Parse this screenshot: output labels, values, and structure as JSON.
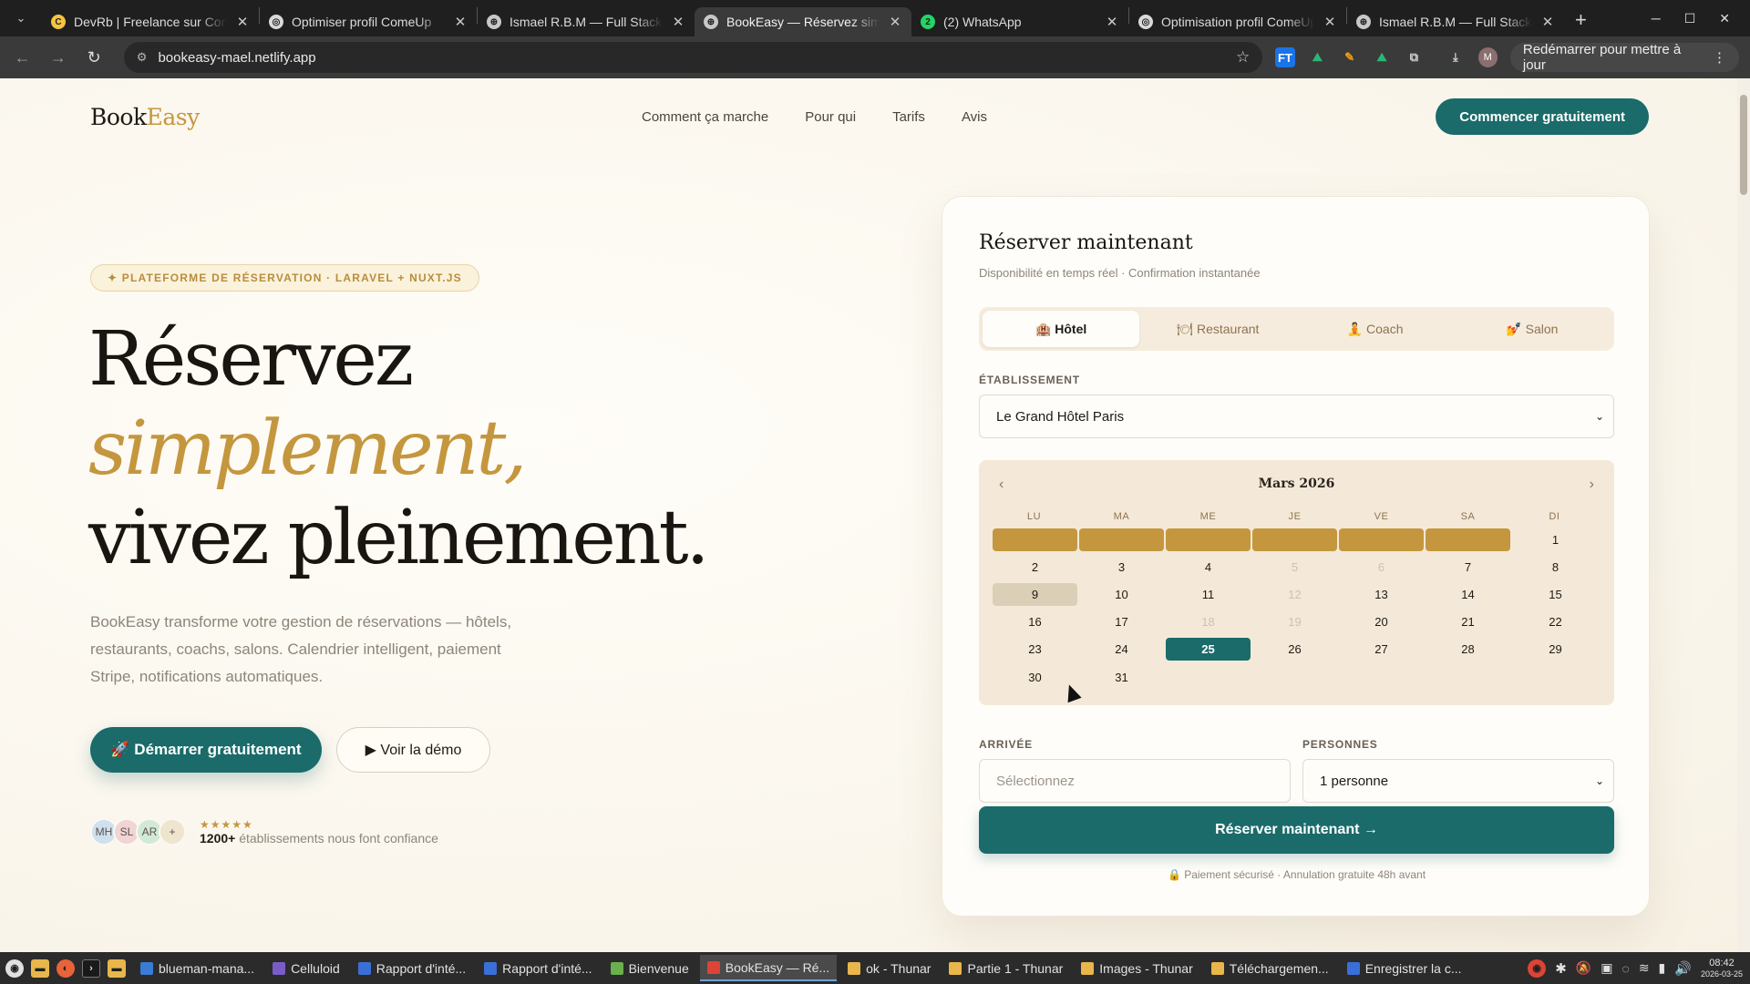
{
  "browser": {
    "tabs": [
      {
        "title": "DevRb | Freelance sur ComeUp",
        "favicon_color": "#f5c542",
        "favicon_glyph": "C"
      },
      {
        "title": "Optimiser profil ComeUp",
        "favicon_color": "#d9d9d9",
        "favicon_glyph": "◎"
      },
      {
        "title": "Ismael R.B.M — Full Stack Developer",
        "favicon_color": "#c8c8c8",
        "favicon_glyph": "⊕"
      },
      {
        "title": "BookEasy — Réservez simplement",
        "favicon_color": "#c8c8c8",
        "favicon_glyph": "⊕"
      },
      {
        "title": "(2) WhatsApp",
        "favicon_color": "#25d366",
        "favicon_glyph": "2"
      },
      {
        "title": "Optimisation profil ComeUp",
        "favicon_color": "#d9d9d9",
        "favicon_glyph": "◎"
      },
      {
        "title": "Ismael R.B.M — Full Stack Developer",
        "favicon_color": "#c8c8c8",
        "favicon_glyph": "⊕"
      }
    ],
    "active_tab": 3,
    "url": "bookeasy-mael.netlify.app",
    "update_label": "Redémarrer pour mettre à jour",
    "profile_initial": "M"
  },
  "site": {
    "logo_part1": "Book",
    "logo_part2": "Easy",
    "nav": [
      "Comment ça marche",
      "Pour qui",
      "Tarifs",
      "Avis"
    ],
    "cta_top": "Commencer gratuitement",
    "badge": "✦ PLATEFORME DE RÉSERVATION · LARAVEL + NUXT.JS",
    "hero_line1": "Réservez",
    "hero_line2": "simplement,",
    "hero_line3": "vivez pleinement.",
    "hero_desc": "BookEasy transforme votre gestion de réservations — hôtels, restaurants, coachs, salons. Calendrier intelligent, paiement Stripe, notifications automatiques.",
    "btn_primary": "🚀 Démarrer gratuitement",
    "btn_secondary": "▶ Voir la démo",
    "avatars": [
      "MH",
      "SL",
      "AR",
      "+"
    ],
    "rating_stars": "★★★★★",
    "social_count": "1200+",
    "social_text": "établissements nous font confiance"
  },
  "booking": {
    "title": "Réserver maintenant",
    "subtitle": "Disponibilité en temps réel · Confirmation instantanée",
    "segments": [
      {
        "label": "🏨 Hôtel",
        "active": true
      },
      {
        "label": "🍽 Restaurant",
        "active": false
      },
      {
        "label": "🧘 Coach",
        "active": false
      },
      {
        "label": "💅 Salon",
        "active": false
      }
    ],
    "establishment_label": "ÉTABLISSEMENT",
    "establishment_value": "Le Grand Hôtel Paris",
    "calendar": {
      "month": "Mars 2026",
      "prev": "‹",
      "next": "›",
      "weekdays": [
        "LU",
        "MA",
        "ME",
        "JE",
        "VE",
        "SA",
        "DI"
      ],
      "weeks": [
        [
          "",
          "",
          "",
          "",
          "",
          "",
          "1"
        ],
        [
          "2",
          "3",
          "4",
          "5",
          "6",
          "7",
          "8"
        ],
        [
          "9",
          "10",
          "11",
          "12",
          "13",
          "14",
          "15"
        ],
        [
          "16",
          "17",
          "18",
          "19",
          "20",
          "21",
          "22"
        ],
        [
          "23",
          "24",
          "25",
          "26",
          "27",
          "28",
          "29"
        ],
        [
          "30",
          "31",
          "",
          "",
          "",
          "",
          ""
        ]
      ],
      "disabled_days": [
        "5",
        "6",
        "12",
        "18",
        "19"
      ],
      "hovered_day": "9",
      "selected_day": "25"
    },
    "arrival_label": "ARRIVÉE",
    "arrival_placeholder": "Sélectionnez",
    "persons_label": "PERSONNES",
    "persons_value": "1 personne",
    "submit": "Réserver maintenant →",
    "secure_note": "🔒 Paiement sécurisé · Annulation gratuite 48h avant"
  },
  "taskbar": {
    "items": [
      {
        "label": "blueman-mana...",
        "color": "#3a7bd5"
      },
      {
        "label": "Celluloid",
        "color": "#7a5cc9"
      },
      {
        "label": "Rapport d'inté...",
        "color": "#3b6fd8"
      },
      {
        "label": "Rapport d'inté...",
        "color": "#3b6fd8"
      },
      {
        "label": "Bienvenue",
        "color": "#6ab04c"
      },
      {
        "label": "BookEasy — Ré...",
        "color": "#db4437"
      },
      {
        "label": "ok - Thunar",
        "color": "#e8b64b"
      },
      {
        "label": "Partie 1 - Thunar",
        "color": "#e8b64b"
      },
      {
        "label": "Images - Thunar",
        "color": "#e8b64b"
      },
      {
        "label": "Téléchargemen...",
        "color": "#e8b64b"
      },
      {
        "label": "Enregistrer la c...",
        "color": "#3b6fd8"
      }
    ],
    "active_item": 5,
    "time": "08:42",
    "date": "2026-03-25"
  }
}
